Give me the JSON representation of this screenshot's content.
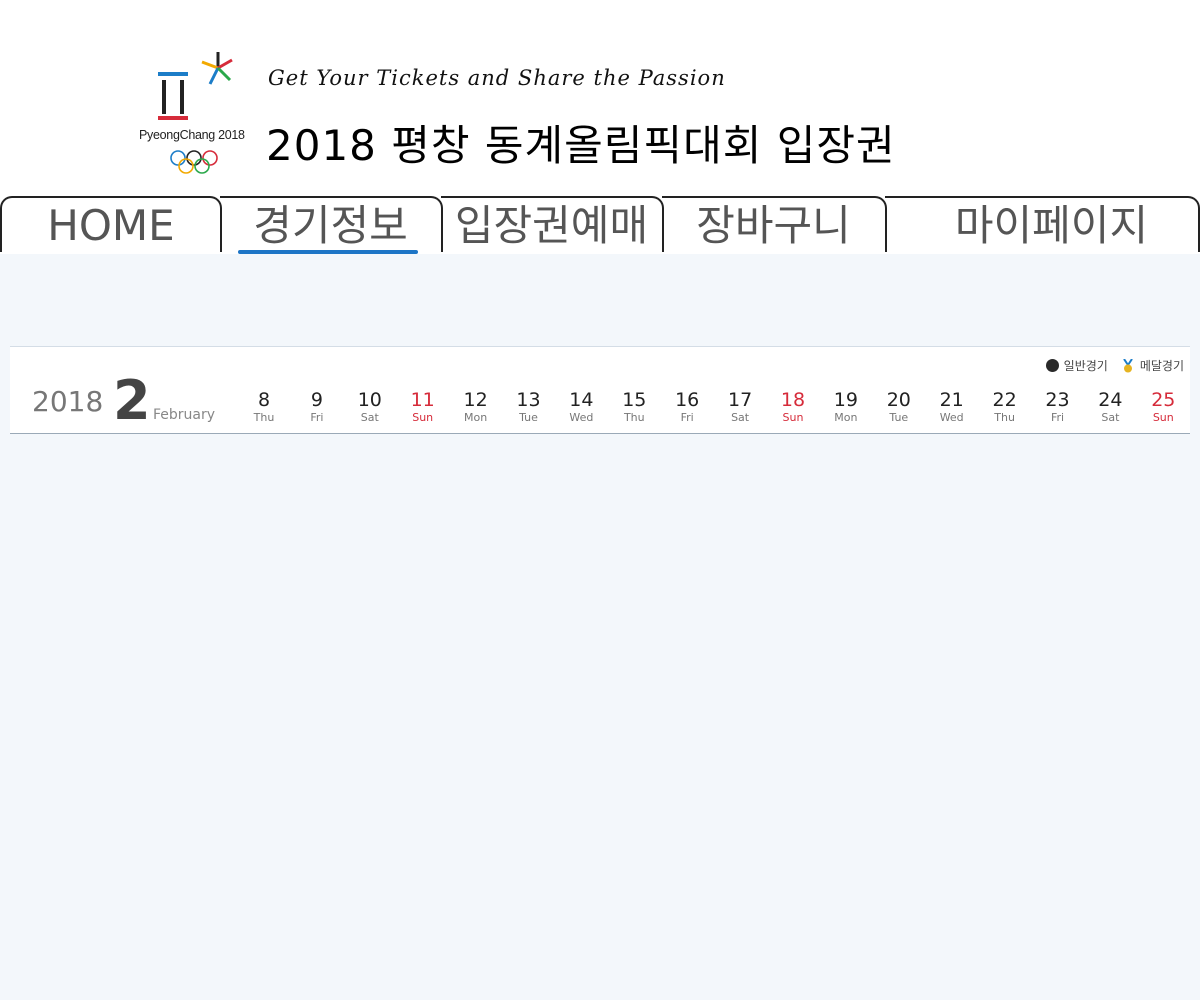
{
  "header": {
    "logo_text": "PyeongChang 2018",
    "tagline": "Get Your Tickets and Share the Passion",
    "title": "2018 평창 동계올림픽대회 입장권"
  },
  "nav": {
    "tabs": [
      {
        "label": "HOME"
      },
      {
        "label": "경기정보",
        "active": true
      },
      {
        "label": "입장권예매"
      },
      {
        "label": "장바구니"
      },
      {
        "label": "마이페이지"
      }
    ]
  },
  "calendar": {
    "year": "2018",
    "month_num": "2",
    "month_name": "February",
    "legend": {
      "general": "일반경기",
      "medal": "메달경기"
    },
    "days": [
      {
        "num": "8",
        "dow": "Thu",
        "sun": false
      },
      {
        "num": "9",
        "dow": "Fri",
        "sun": false
      },
      {
        "num": "10",
        "dow": "Sat",
        "sun": false
      },
      {
        "num": "11",
        "dow": "Sun",
        "sun": true
      },
      {
        "num": "12",
        "dow": "Mon",
        "sun": false
      },
      {
        "num": "13",
        "dow": "Tue",
        "sun": false
      },
      {
        "num": "14",
        "dow": "Wed",
        "sun": false
      },
      {
        "num": "15",
        "dow": "Thu",
        "sun": false
      },
      {
        "num": "16",
        "dow": "Fri",
        "sun": false
      },
      {
        "num": "17",
        "dow": "Sat",
        "sun": false
      },
      {
        "num": "18",
        "dow": "Sun",
        "sun": true
      },
      {
        "num": "19",
        "dow": "Mon",
        "sun": false
      },
      {
        "num": "20",
        "dow": "Tue",
        "sun": false
      },
      {
        "num": "21",
        "dow": "Wed",
        "sun": false
      },
      {
        "num": "22",
        "dow": "Thu",
        "sun": false
      },
      {
        "num": "23",
        "dow": "Fri",
        "sun": false
      },
      {
        "num": "24",
        "dow": "Sat",
        "sun": false
      },
      {
        "num": "25",
        "dow": "Sun",
        "sun": true
      }
    ]
  },
  "colors": {
    "accent": "#1d75c6",
    "sunday": "#d62b3a",
    "page_bg": "#f3f7fb"
  }
}
